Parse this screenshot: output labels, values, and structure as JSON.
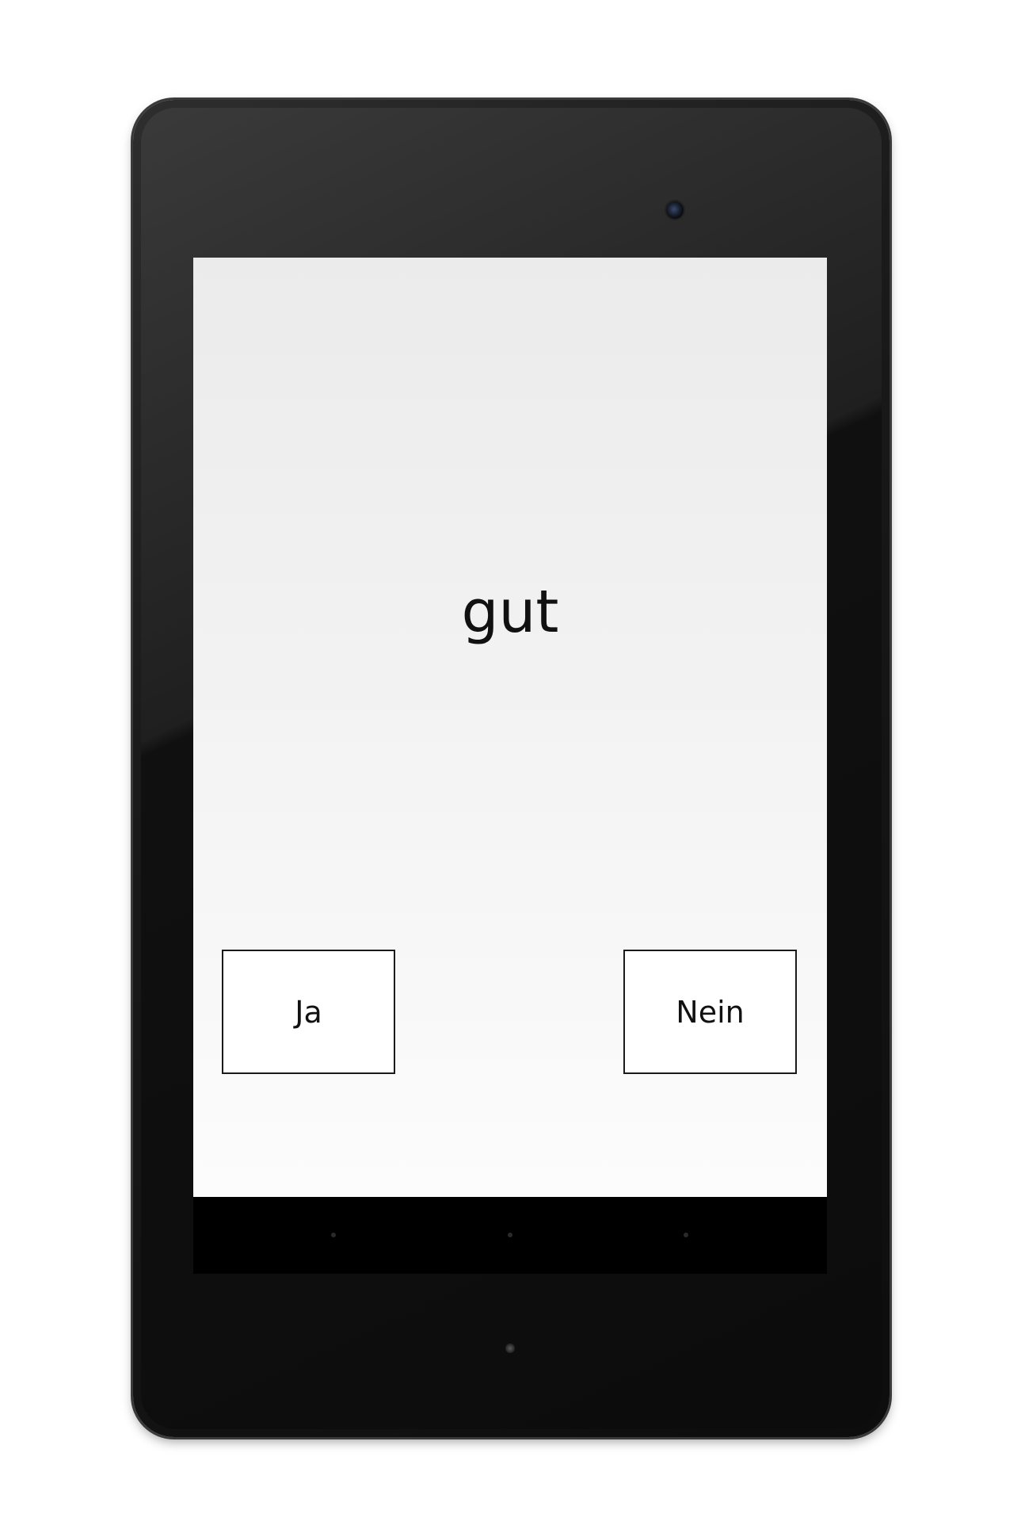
{
  "app": {
    "word": "gut"
  },
  "buttons": {
    "yes_label": "Ja",
    "no_label": "Nein"
  },
  "navigation_bar": {
    "items": [
      "back-icon",
      "home-icon",
      "recent-apps-icon"
    ]
  },
  "colors": {
    "device_body": "#0d0d0d",
    "screen_background": "#f0f0f0",
    "text": "#111111",
    "button_border": "#1a1a1a",
    "navbar": "#000000"
  }
}
